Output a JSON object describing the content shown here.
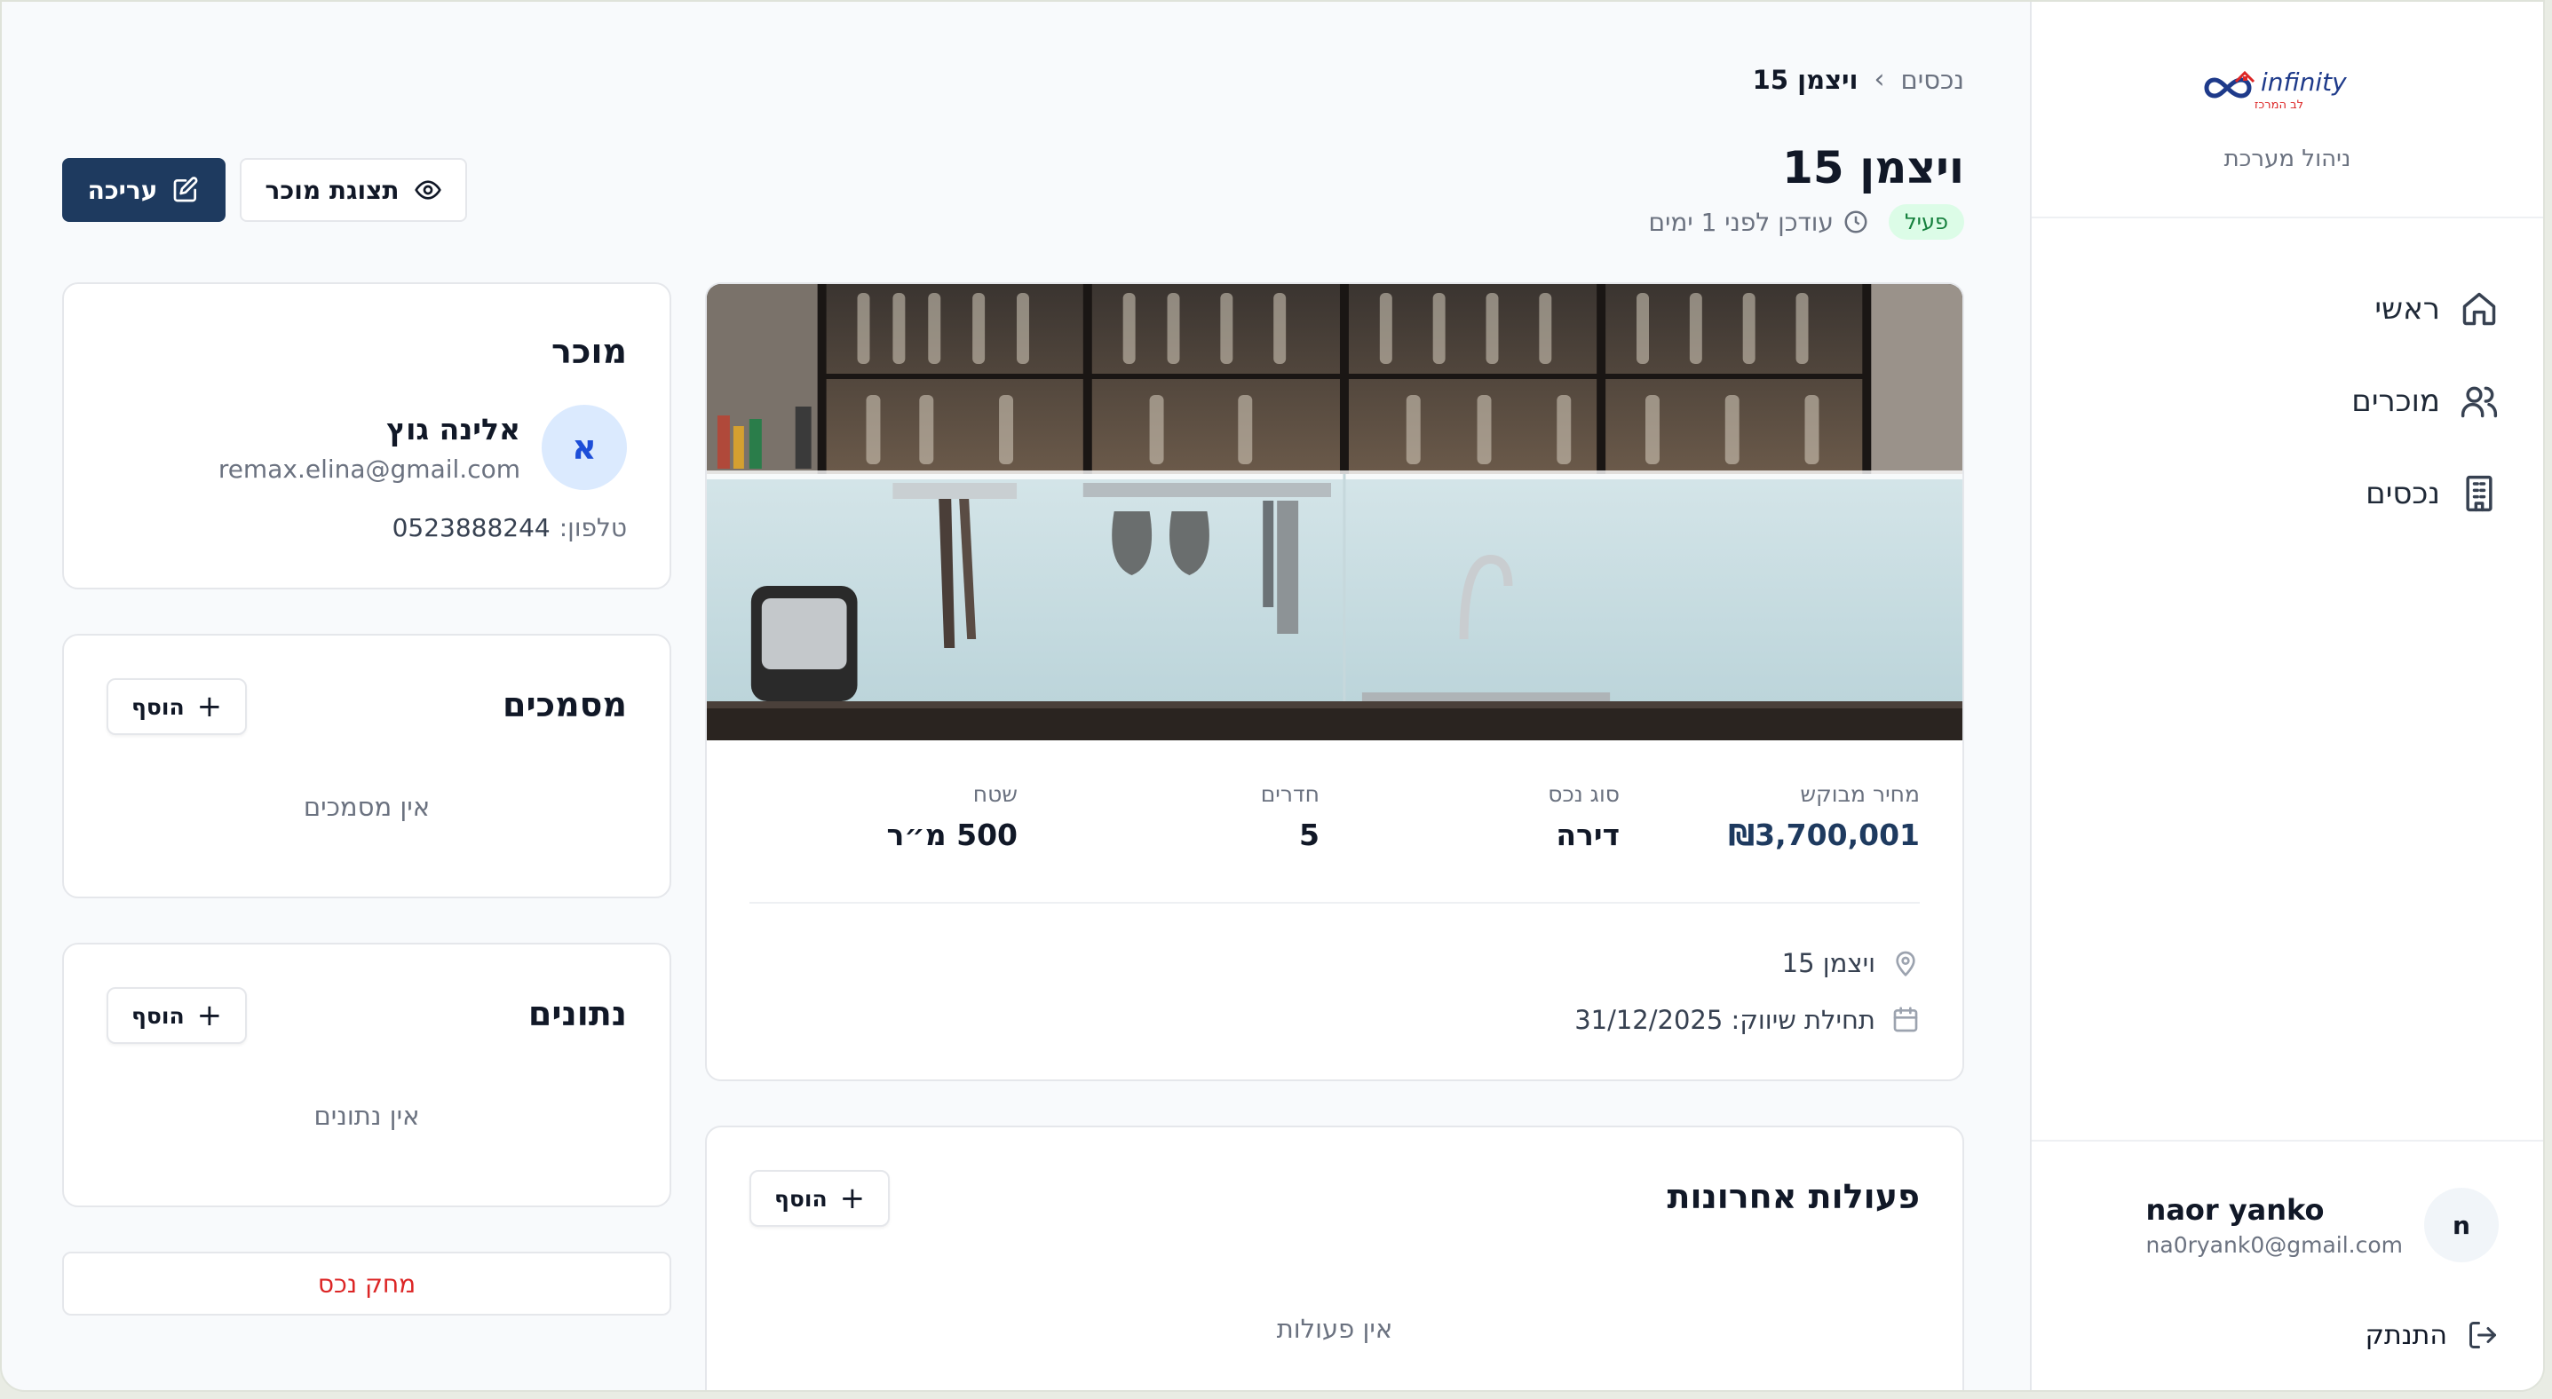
{
  "app": {
    "logo_text": "infinity",
    "logo_subtext": "לב המרכז",
    "subtitle": "ניהול מערכת"
  },
  "sidebar": {
    "items": [
      {
        "label": "ראשי",
        "icon": "home-icon"
      },
      {
        "label": "מוכרים",
        "icon": "users-icon"
      },
      {
        "label": "נכסים",
        "icon": "building-icon"
      }
    ]
  },
  "user": {
    "initial": "n",
    "name": "naor yanko",
    "email": "na0ryank0@gmail.com",
    "logout_label": "התנתק"
  },
  "breadcrumb": {
    "parent": "נכסים",
    "current": "ויצמן 15"
  },
  "page": {
    "title": "ויצמן 15",
    "status": "פעיל",
    "updated": "עודכן לפני 1 ימים"
  },
  "actions": {
    "edit_label": "עריכה",
    "preview_label": "תצוגת מוכר"
  },
  "property": {
    "stats": [
      {
        "label": "מחיר מבוקש",
        "value": "₪3,700,001"
      },
      {
        "label": "סוג נכס",
        "value": "דירה"
      },
      {
        "label": "חדרים",
        "value": "5"
      },
      {
        "label": "שטח",
        "value": "500 מ״ר"
      }
    ],
    "address": "ויצמן 15",
    "marketing_start": "תחילת שיווק: 31/12/2025"
  },
  "activity": {
    "title": "פעולות אחרונות",
    "add_label": "הוסף",
    "empty": "אין פעולות"
  },
  "seller": {
    "title": "מוכר",
    "initial": "א",
    "name": "אלינה גוץ",
    "email": "remax.elina@gmail.com",
    "phone_label": "טלפון:",
    "phone": "0523888244"
  },
  "documents": {
    "title": "מסמכים",
    "add_label": "הוסף",
    "empty": "אין מסמכים"
  },
  "data_section": {
    "title": "נתונים",
    "add_label": "הוסף",
    "empty": "אין נתונים"
  },
  "delete_label": "מחק נכס",
  "colors": {
    "primary": "#1e3a5f",
    "status_bg": "#dcfce7",
    "status_text": "#15803d",
    "danger": "#dc2626"
  }
}
